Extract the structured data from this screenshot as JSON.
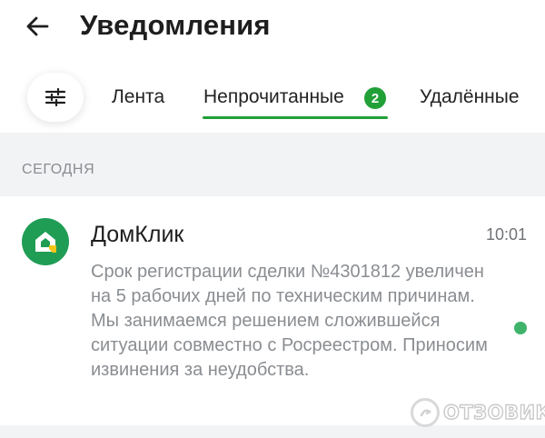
{
  "header": {
    "title": "Уведомления",
    "back_icon": "arrow-left-icon"
  },
  "tabs": {
    "filter_icon": "sliders-icon",
    "items": [
      {
        "label": "Лента"
      },
      {
        "label": "Непрочитанные",
        "badge": "2",
        "active": true
      },
      {
        "label": "Удалённые"
      }
    ]
  },
  "section": {
    "label": "СЕГОДНЯ"
  },
  "notification": {
    "sender": "ДомКлик",
    "time": "10:01",
    "body": "Срок регистрации сделки №4301812 увеличен на 5 рабочих дней по техническим причинам. Мы занимаемся решением сложившейся ситуации совместно с Росреестром. Приносим извинения за неудобства.",
    "unread": true,
    "logo_icon": "domclick-logo"
  },
  "watermark": {
    "text": "ОТЗОВИК"
  },
  "colors": {
    "accent": "#21a038",
    "unread_dot": "#3fb36a",
    "logo_bg": "#1f9d55",
    "section_bg": "#f2f3f5",
    "muted_text": "#8a8d91"
  }
}
